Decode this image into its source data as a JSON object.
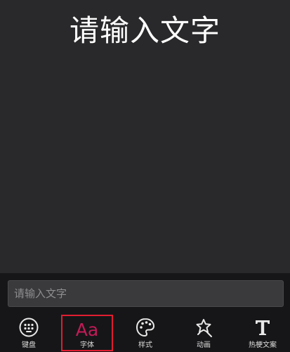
{
  "preview": {
    "text": "请输入文字"
  },
  "input": {
    "placeholder": "请输入文字",
    "value": ""
  },
  "toolbar": {
    "selected": "font",
    "items": [
      {
        "key": "keyboard",
        "label": "键盘",
        "icon": "keyboard-icon"
      },
      {
        "key": "font",
        "label": "字体",
        "icon": "font-aa-icon",
        "glyph": "Aa"
      },
      {
        "key": "style",
        "label": "样式",
        "icon": "palette-icon"
      },
      {
        "key": "animation",
        "label": "动画",
        "icon": "sparkle-star-icon"
      },
      {
        "key": "hot-copy",
        "label": "热梗文案",
        "icon": "text-t-icon"
      }
    ]
  },
  "colors": {
    "accent": "#c21b57",
    "selection_border": "#e21d31",
    "stage_background": "#29292b",
    "panel_background": "#161618"
  }
}
